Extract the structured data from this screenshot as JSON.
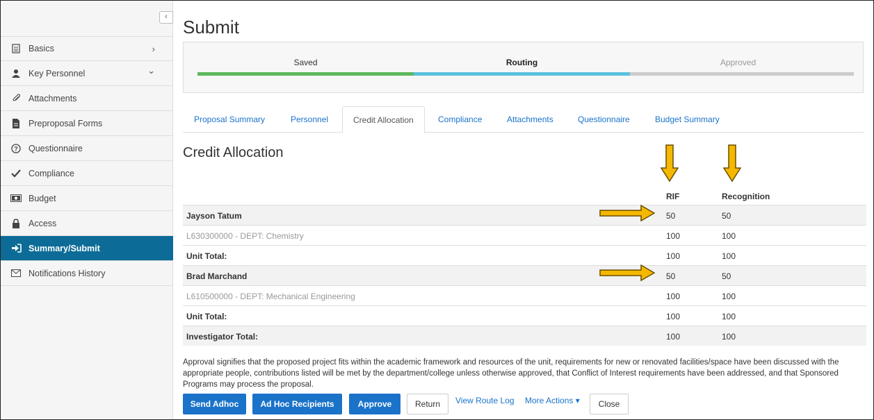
{
  "sidebar": {
    "collapse_glyph": "‹",
    "items": [
      {
        "label": "Basics",
        "icon": "document-icon",
        "chevron": "›"
      },
      {
        "label": "Key Personnel",
        "icon": "person-icon",
        "chevron": "⌄"
      },
      {
        "label": "Attachments",
        "icon": "paperclip-icon"
      },
      {
        "label": "Preproposal Forms",
        "icon": "file-icon"
      },
      {
        "label": "Questionnaire",
        "icon": "question-circle-icon"
      },
      {
        "label": "Compliance",
        "icon": "check-icon"
      },
      {
        "label": "Budget",
        "icon": "money-icon"
      },
      {
        "label": "Access",
        "icon": "lock-icon"
      },
      {
        "label": "Summary/Submit",
        "icon": "sign-in-icon",
        "active": true
      },
      {
        "label": "Notifications History",
        "icon": "envelope-icon"
      }
    ]
  },
  "page": {
    "title": "Submit"
  },
  "progress": {
    "steps": [
      {
        "label": "Saved",
        "status": "complete"
      },
      {
        "label": "Routing",
        "status": "current"
      },
      {
        "label": "Approved",
        "status": "pending"
      }
    ],
    "colors": {
      "complete": "#5cb85c",
      "current": "#5bc0de",
      "pending": "#cccccc"
    }
  },
  "tabs": [
    {
      "label": "Proposal Summary"
    },
    {
      "label": "Personnel"
    },
    {
      "label": "Credit Allocation",
      "active": true
    },
    {
      "label": "Compliance"
    },
    {
      "label": "Attachments"
    },
    {
      "label": "Questionnaire"
    },
    {
      "label": "Budget Summary"
    }
  ],
  "credit": {
    "title": "Credit Allocation",
    "col1": "RIF",
    "col2": "Recognition",
    "rows": [
      {
        "name": "Jayson Tatum",
        "v1": "50",
        "v2": "50",
        "kind": "person"
      },
      {
        "name": "L630300000 - DEPT: Chemistry",
        "v1": "100",
        "v2": "100",
        "kind": "dept"
      },
      {
        "name": "Unit Total:",
        "v1": "100",
        "v2": "100",
        "kind": "total"
      },
      {
        "name": "Brad Marchand",
        "v1": "50",
        "v2": "50",
        "kind": "person"
      },
      {
        "name": "L610500000 - DEPT: Mechanical Engineering",
        "v1": "100",
        "v2": "100",
        "kind": "dept"
      },
      {
        "name": "Unit Total:",
        "v1": "100",
        "v2": "100",
        "kind": "total"
      },
      {
        "name": "Investigator Total:",
        "v1": "100",
        "v2": "100",
        "kind": "total"
      }
    ]
  },
  "approval_text": "Approval signifies that the proposed project fits within the academic framework and resources of the unit, requirements for new or renovated facilities/space have been discussed with the appropriate people, contributions listed will be met by the department/college unless otherwise approved, that Conflict of Interest requirements have been addressed, and that Sponsored Programs may process the proposal.",
  "actions": {
    "send_adhoc": "Send Adhoc",
    "adhoc_recipients": "Ad Hoc Recipients",
    "approve": "Approve",
    "return": "Return",
    "view_route_log": "View Route Log",
    "more_actions": "More Actions ▾",
    "close": "Close"
  },
  "annotation_color": "#f5b800"
}
